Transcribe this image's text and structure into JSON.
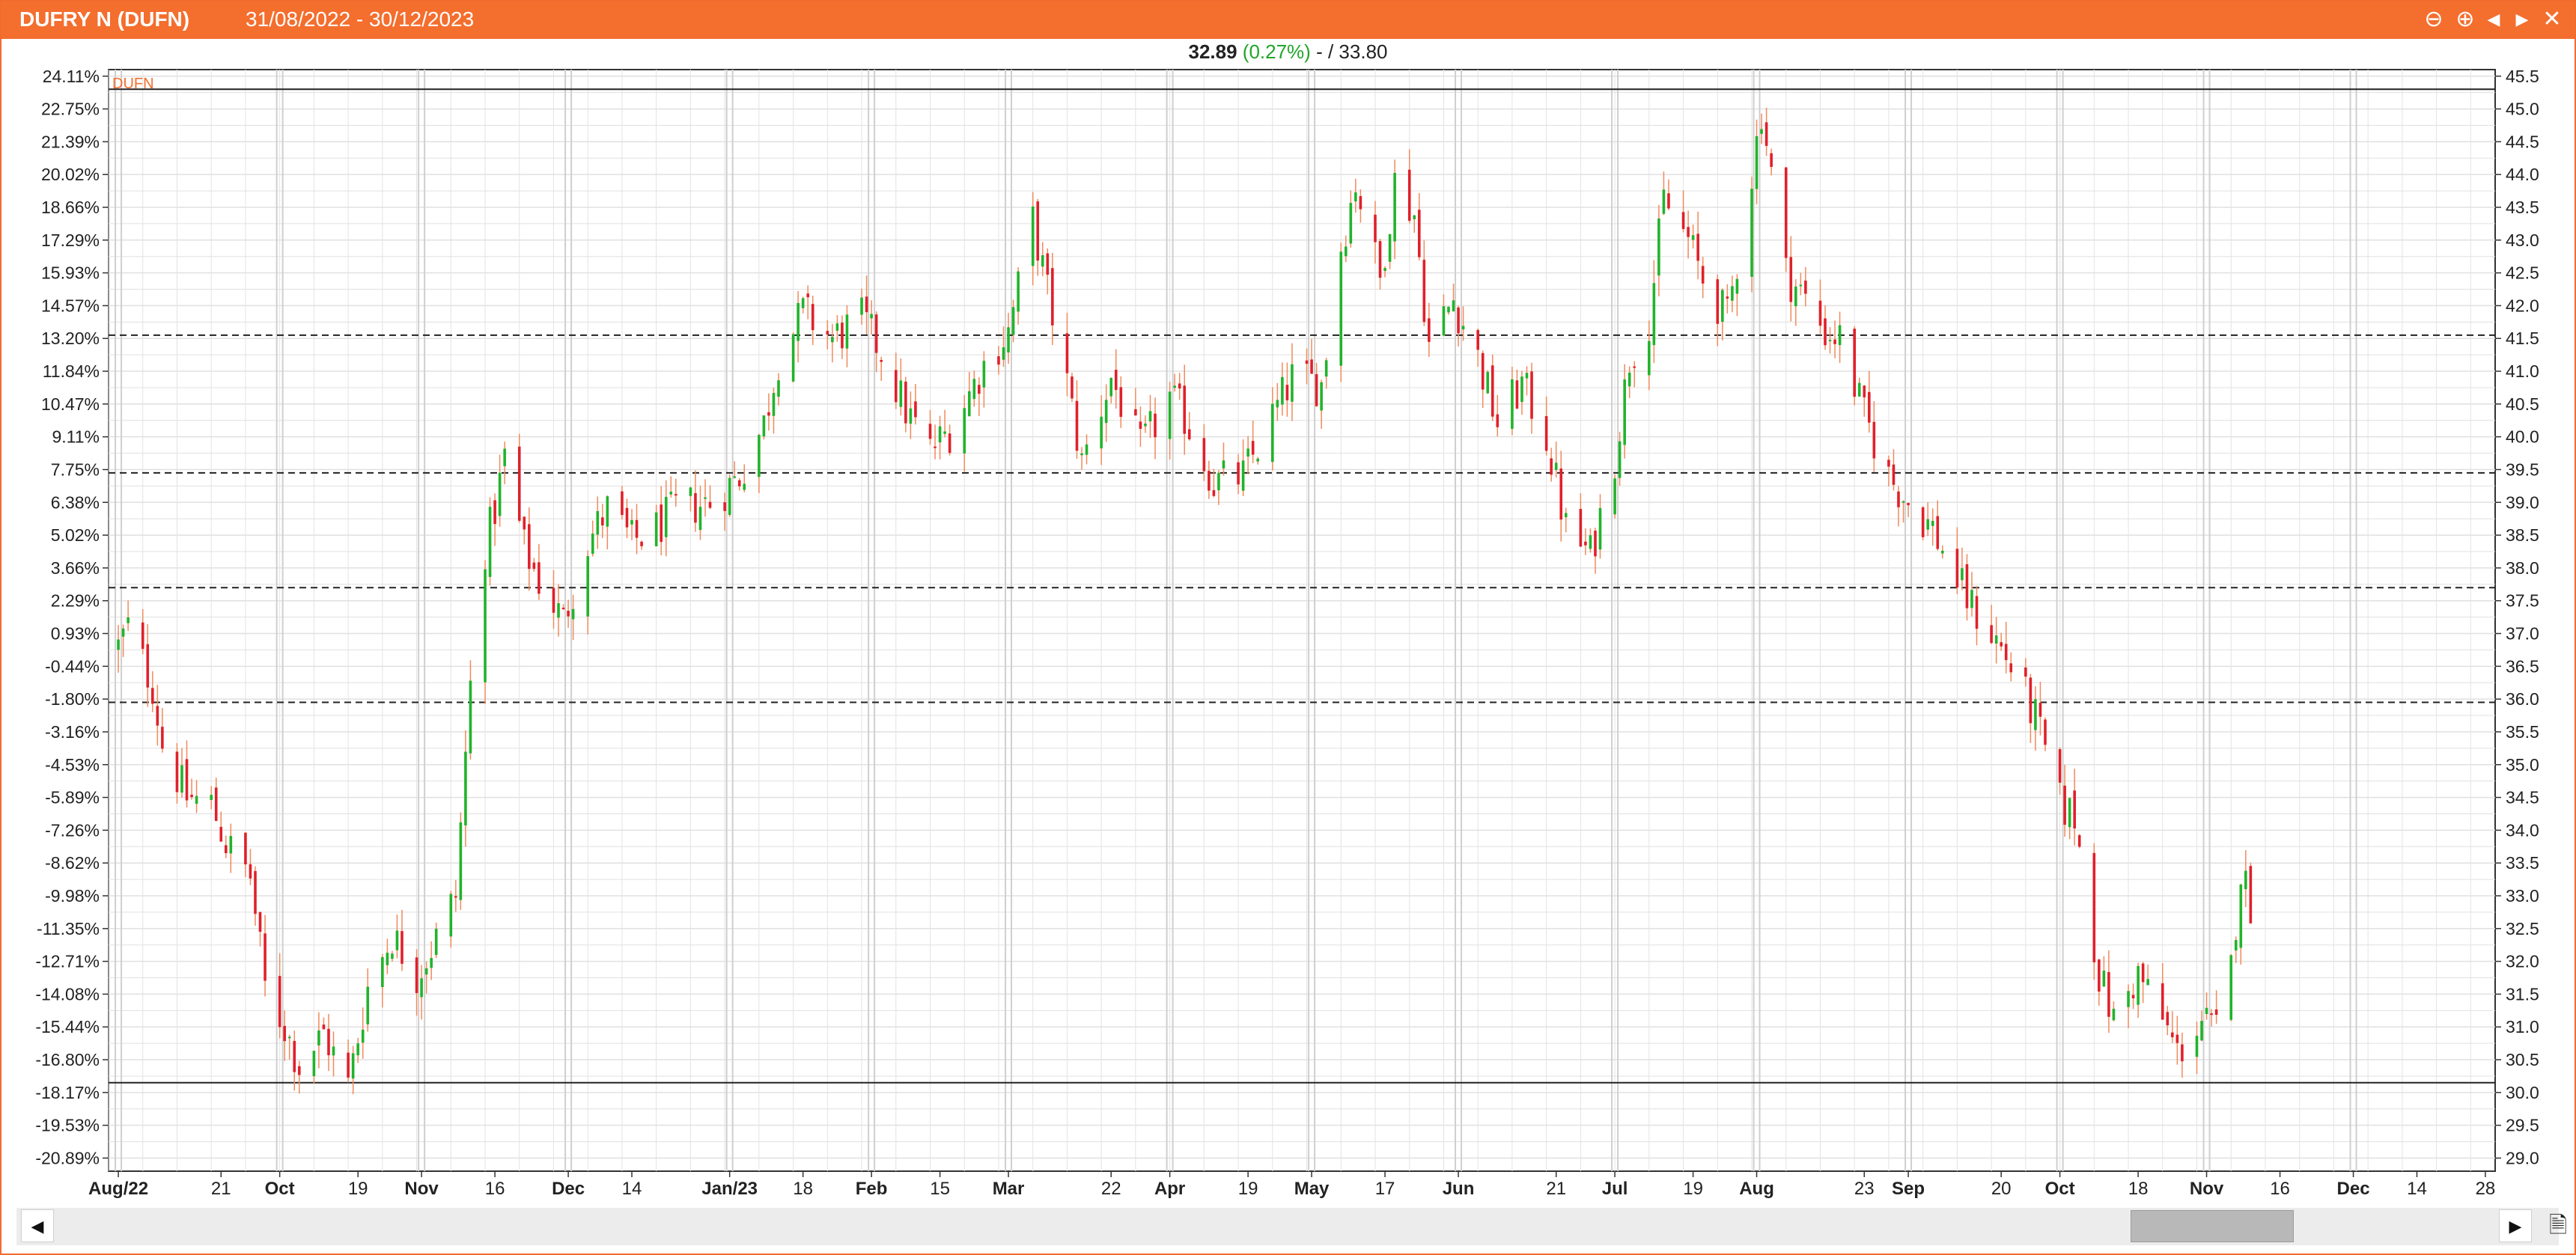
{
  "window": {
    "title": "DUFRY N (DUFN)",
    "date_range": "31/08/2022 - 30/12/2023"
  },
  "quote": {
    "last": "32.89",
    "change": "(0.27%)",
    "separator": "- /",
    "reference": "33.80"
  },
  "colors": {
    "accent": "#f46e2e",
    "up": "#21b32b",
    "down": "#e0202a",
    "wick": "#f08a5d"
  },
  "icons": [
    "minus-circle-icon",
    "plus-circle-icon",
    "triangle-left-icon",
    "triangle-right-icon",
    "close-icon",
    "scroll-left-icon",
    "scroll-right-icon",
    "document-icon"
  ],
  "chart_data": {
    "type": "candlestick",
    "symbol_label": "DUFN",
    "reference_price": 33.8,
    "ylim": [
      28.8,
      45.6
    ],
    "x_range": [
      "2022-08-29",
      "2023-12-30"
    ],
    "grid": true,
    "y_right_ticks": [
      "29.0",
      "29.5",
      "30.0",
      "30.5",
      "31.0",
      "31.5",
      "32.0",
      "32.5",
      "33.0",
      "33.5",
      "34.0",
      "34.5",
      "35.0",
      "35.5",
      "36.0",
      "36.5",
      "37.0",
      "37.5",
      "38.0",
      "38.5",
      "39.0",
      "39.5",
      "40.0",
      "40.5",
      "41.0",
      "41.5",
      "42.0",
      "42.5",
      "43.0",
      "43.5",
      "44.0",
      "44.5",
      "45.0",
      "45.5"
    ],
    "y_left_ticks": [
      "24.11%",
      "22.75%",
      "21.39%",
      "20.02%",
      "18.66%",
      "17.29%",
      "15.93%",
      "14.57%",
      "13.20%",
      "11.84%",
      "10.47%",
      "9.11%",
      "7.75%",
      "6.38%",
      "5.02%",
      "3.66%",
      "2.29%",
      "0.93%",
      "-0.44%",
      "-1.80%",
      "-3.16%",
      "-4.53%",
      "-5.89%",
      "-7.26%",
      "-8.62%",
      "-9.98%",
      "-11.35%",
      "-12.71%",
      "-14.08%",
      "-15.44%",
      "-16.80%",
      "-18.17%",
      "-19.53%",
      "-20.89%"
    ],
    "x_labels": [
      {
        "date": "2022-08-31",
        "label": "Aug/22",
        "bold": true
      },
      {
        "date": "2022-09-21",
        "label": "21",
        "bold": false
      },
      {
        "date": "2022-10-03",
        "label": "Oct",
        "bold": true
      },
      {
        "date": "2022-10-19",
        "label": "19",
        "bold": false
      },
      {
        "date": "2022-11-01",
        "label": "Nov",
        "bold": true
      },
      {
        "date": "2022-11-16",
        "label": "16",
        "bold": false
      },
      {
        "date": "2022-12-01",
        "label": "Dec",
        "bold": true
      },
      {
        "date": "2022-12-14",
        "label": "14",
        "bold": false
      },
      {
        "date": "2023-01-03",
        "label": "Jan/23",
        "bold": true
      },
      {
        "date": "2023-01-18",
        "label": "18",
        "bold": false
      },
      {
        "date": "2023-02-01",
        "label": "Feb",
        "bold": true
      },
      {
        "date": "2023-02-15",
        "label": "15",
        "bold": false
      },
      {
        "date": "2023-03-01",
        "label": "Mar",
        "bold": true
      },
      {
        "date": "2023-03-22",
        "label": "22",
        "bold": false
      },
      {
        "date": "2023-04-03",
        "label": "Apr",
        "bold": true
      },
      {
        "date": "2023-04-19",
        "label": "19",
        "bold": false
      },
      {
        "date": "2023-05-02",
        "label": "May",
        "bold": true
      },
      {
        "date": "2023-05-17",
        "label": "17",
        "bold": false
      },
      {
        "date": "2023-06-01",
        "label": "Jun",
        "bold": true
      },
      {
        "date": "2023-06-21",
        "label": "21",
        "bold": false
      },
      {
        "date": "2023-07-03",
        "label": "Jul",
        "bold": true
      },
      {
        "date": "2023-07-19",
        "label": "19",
        "bold": false
      },
      {
        "date": "2023-08-01",
        "label": "Aug",
        "bold": true
      },
      {
        "date": "2023-08-23",
        "label": "23",
        "bold": false
      },
      {
        "date": "2023-09-01",
        "label": "Sep",
        "bold": true
      },
      {
        "date": "2023-09-20",
        "label": "20",
        "bold": false
      },
      {
        "date": "2023-10-02",
        "label": "Oct",
        "bold": true
      },
      {
        "date": "2023-10-18",
        "label": "18",
        "bold": false
      },
      {
        "date": "2023-11-01",
        "label": "Nov",
        "bold": true
      },
      {
        "date": "2023-11-16",
        "label": "16",
        "bold": false
      },
      {
        "date": "2023-12-01",
        "label": "Dec",
        "bold": true
      },
      {
        "date": "2023-12-14",
        "label": "14",
        "bold": false
      },
      {
        "date": "2023-12-28",
        "label": "28",
        "bold": false
      }
    ],
    "horizontal_lines": [
      {
        "value": 45.3,
        "style": "solid"
      },
      {
        "value": 41.55,
        "style": "dashed"
      },
      {
        "value": 39.45,
        "style": "dashed"
      },
      {
        "value": 37.7,
        "style": "dashed"
      },
      {
        "value": 35.95,
        "style": "dashed"
      },
      {
        "value": 30.15,
        "style": "solid"
      }
    ],
    "close_path": [
      [
        "2022-08-31",
        36.8
      ],
      [
        "2022-09-02",
        37.1
      ],
      [
        "2022-09-07",
        36.2
      ],
      [
        "2022-09-09",
        35.3
      ],
      [
        "2022-09-14",
        34.5
      ],
      [
        "2022-09-19",
        34.4
      ],
      [
        "2022-09-22",
        33.8
      ],
      [
        "2022-09-27",
        33.3
      ],
      [
        "2022-09-30",
        31.6
      ],
      [
        "2022-10-04",
        31.0
      ],
      [
        "2022-10-07",
        30.4
      ],
      [
        "2022-10-12",
        30.9
      ],
      [
        "2022-10-17",
        30.1
      ],
      [
        "2022-10-21",
        31.6
      ],
      [
        "2022-10-26",
        32.4
      ],
      [
        "2022-10-31",
        31.8
      ],
      [
        "2022-11-03",
        32.2
      ],
      [
        "2022-11-08",
        33.0
      ],
      [
        "2022-11-11",
        36.2
      ],
      [
        "2022-11-14",
        38.3
      ],
      [
        "2022-11-16",
        38.9
      ],
      [
        "2022-11-18",
        39.7
      ],
      [
        "2022-11-22",
        38.3
      ],
      [
        "2022-11-25",
        37.8
      ],
      [
        "2022-11-30",
        37.2
      ],
      [
        "2022-12-05",
        38.4
      ],
      [
        "2022-12-09",
        38.9
      ],
      [
        "2022-12-14",
        38.4
      ],
      [
        "2022-12-19",
        38.6
      ],
      [
        "2022-12-23",
        38.9
      ],
      [
        "2022-12-30",
        39.0
      ],
      [
        "2023-01-05",
        39.4
      ],
      [
        "2023-01-10",
        40.2
      ],
      [
        "2023-01-13",
        41.2
      ],
      [
        "2023-01-18",
        41.9
      ],
      [
        "2023-01-24",
        41.5
      ],
      [
        "2023-01-30",
        41.8
      ],
      [
        "2023-02-03",
        41.3
      ],
      [
        "2023-02-08",
        40.4
      ],
      [
        "2023-02-13",
        39.8
      ],
      [
        "2023-02-17",
        40.1
      ],
      [
        "2023-02-24",
        41.1
      ],
      [
        "2023-03-01",
        41.6
      ],
      [
        "2023-03-06",
        43.3
      ],
      [
        "2023-03-09",
        42.2
      ],
      [
        "2023-03-13",
        40.8
      ],
      [
        "2023-03-16",
        39.6
      ],
      [
        "2023-03-22",
        40.9
      ],
      [
        "2023-03-28",
        39.8
      ],
      [
        "2023-04-03",
        40.6
      ],
      [
        "2023-04-06",
        40.3
      ],
      [
        "2023-04-12",
        39.3
      ],
      [
        "2023-04-18",
        39.4
      ],
      [
        "2023-04-24",
        40.3
      ],
      [
        "2023-04-28",
        40.9
      ],
      [
        "2023-05-04",
        40.8
      ],
      [
        "2023-05-08",
        42.9
      ],
      [
        "2023-05-11",
        43.9
      ],
      [
        "2023-05-16",
        42.4
      ],
      [
        "2023-05-19",
        43.9
      ],
      [
        "2023-05-23",
        43.4
      ],
      [
        "2023-05-26",
        41.4
      ],
      [
        "2023-05-31",
        42.1
      ],
      [
        "2023-06-05",
        41.2
      ],
      [
        "2023-06-09",
        40.2
      ],
      [
        "2023-06-14",
        40.8
      ],
      [
        "2023-06-19",
        40.0
      ],
      [
        "2023-06-23",
        38.6
      ],
      [
        "2023-06-28",
        38.2
      ],
      [
        "2023-07-03",
        39.7
      ],
      [
        "2023-07-06",
        41.2
      ],
      [
        "2023-07-10",
        41.8
      ],
      [
        "2023-07-13",
        43.6
      ],
      [
        "2023-07-18",
        43.0
      ],
      [
        "2023-07-21",
        42.4
      ],
      [
        "2023-07-26",
        41.8
      ],
      [
        "2023-07-31",
        44.0
      ],
      [
        "2023-08-02",
        45.0
      ],
      [
        "2023-08-07",
        42.5
      ],
      [
        "2023-08-10",
        42.2
      ],
      [
        "2023-08-15",
        41.6
      ],
      [
        "2023-08-18",
        41.5
      ],
      [
        "2023-08-23",
        40.3
      ],
      [
        "2023-08-28",
        39.4
      ],
      [
        "2023-09-01",
        39.0
      ],
      [
        "2023-09-06",
        38.6
      ],
      [
        "2023-09-11",
        37.8
      ],
      [
        "2023-09-14",
        37.4
      ],
      [
        "2023-09-19",
        36.9
      ],
      [
        "2023-09-22",
        36.5
      ],
      [
        "2023-09-27",
        35.7
      ],
      [
        "2023-10-02",
        34.4
      ],
      [
        "2023-10-05",
        34.2
      ],
      [
        "2023-10-10",
        31.8
      ],
      [
        "2023-10-13",
        31.1
      ],
      [
        "2023-10-18",
        31.8
      ],
      [
        "2023-10-23",
        31.1
      ],
      [
        "2023-10-26",
        30.6
      ],
      [
        "2023-10-31",
        31.1
      ],
      [
        "2023-11-03",
        30.9
      ],
      [
        "2023-11-06",
        31.9
      ],
      [
        "2023-11-08",
        33.4
      ],
      [
        "2023-11-10",
        32.9
      ]
    ]
  }
}
